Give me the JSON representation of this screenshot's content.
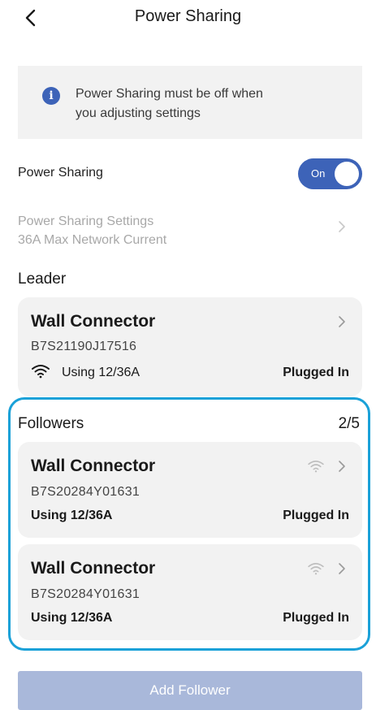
{
  "header": {
    "title": "Power Sharing"
  },
  "notice": {
    "text_line1": "Power Sharing must be off when",
    "text_line2": "you adjusting settings"
  },
  "power_sharing": {
    "label": "Power Sharing",
    "toggle_label": "On"
  },
  "settings": {
    "title": "Power Sharing Settings",
    "subtitle": "36A Max Network Current"
  },
  "leader": {
    "section_label": "Leader",
    "card": {
      "title": "Wall Connector",
      "serial": "B7S21190J17516",
      "usage": "Using 12/36A",
      "status": "Plugged In"
    }
  },
  "followers": {
    "section_label": "Followers",
    "count": "2/5",
    "items": [
      {
        "title": "Wall Connector",
        "serial": "B7S20284Y01631",
        "usage": "Using 12/36A",
        "status": "Plugged In"
      },
      {
        "title": "Wall Connector",
        "serial": "B7S20284Y01631",
        "usage": "Using 12/36A",
        "status": "Plugged In"
      }
    ]
  },
  "add_button": {
    "label": "Add Follower"
  },
  "colors": {
    "accent": "#3d63b8",
    "highlight_border": "#1aa1d8",
    "card_bg": "#f2f2f2",
    "disabled_button": "#a9b8da"
  }
}
